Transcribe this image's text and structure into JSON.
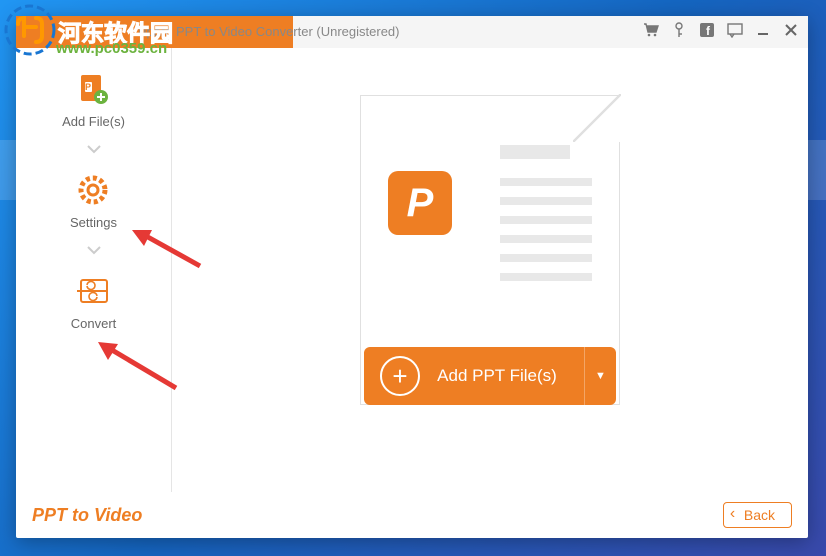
{
  "window": {
    "title": "Tipard PPT to Video Converter (Unregistered)"
  },
  "watermark": {
    "site_cn": "河东软件园",
    "url": "www.pc0359.cn"
  },
  "sidebar": {
    "items": [
      {
        "label": "Add File(s)"
      },
      {
        "label": "Settings"
      },
      {
        "label": "Convert"
      }
    ]
  },
  "main": {
    "add_button_label": "Add PPT File(s)"
  },
  "footer": {
    "brand": "PPT to Video",
    "back_label": "Back"
  }
}
